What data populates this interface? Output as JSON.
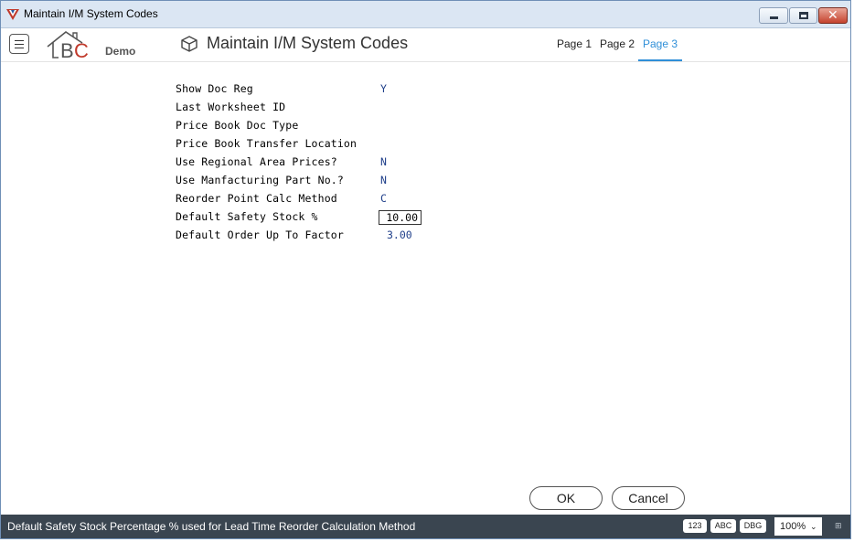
{
  "window": {
    "title": "Maintain I/M System Codes"
  },
  "header": {
    "brand_demo": "Demo",
    "page_title": "Maintain I/M System Codes",
    "tabs": [
      {
        "label": "Page 1",
        "active": false
      },
      {
        "label": "Page 2",
        "active": false
      },
      {
        "label": "Page 3",
        "active": true
      }
    ]
  },
  "form": {
    "fields": [
      {
        "label": "Show Doc Reg",
        "value": "Y"
      },
      {
        "label": "Last Worksheet ID",
        "value": ""
      },
      {
        "label": "Price Book Doc Type",
        "value": ""
      },
      {
        "label": "Price Book Transfer Location",
        "value": ""
      },
      {
        "label": "Use Regional Area Prices?",
        "value": "N"
      },
      {
        "label": "Use Manfacturing Part No.?",
        "value": "N"
      },
      {
        "label": "Reorder Point Calc Method",
        "value": "C"
      },
      {
        "label": "Default Safety Stock %",
        "value": "10.00"
      },
      {
        "label": "Default Order Up To Factor",
        "value": "3.00"
      }
    ]
  },
  "buttons": {
    "ok": "OK",
    "cancel": "Cancel"
  },
  "statusbar": {
    "message": "Default Safety Stock Percentage % used for Lead Time Reorder Calculation Method",
    "btn_123": "123",
    "btn_abc": "ABC",
    "btn_dbg": "DBG",
    "zoom": "100%"
  },
  "colors": {
    "accent": "#2f8fd8",
    "value_text": "#1f3f8a",
    "statusbar_bg": "#3a4550",
    "titlebar_bg": "#dbe6f3"
  },
  "icons": [
    "app-icon",
    "menu-icon",
    "module-box-icon",
    "chevron-down-icon",
    "resize-grip-icon"
  ]
}
